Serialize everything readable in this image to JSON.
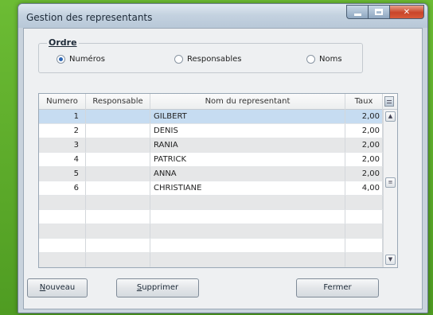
{
  "window": {
    "title": "Gestion des representants"
  },
  "ordre": {
    "label": "Ordre",
    "options": [
      {
        "label": "Numéros",
        "selected": true
      },
      {
        "label": "Responsables",
        "selected": false
      },
      {
        "label": "Noms",
        "selected": false
      }
    ]
  },
  "table": {
    "columns": [
      "Numero",
      "Responsable",
      "Nom du representant",
      "Taux"
    ],
    "rows": [
      {
        "numero": "1",
        "responsable": "",
        "nom": "GILBERT",
        "taux": "2,00"
      },
      {
        "numero": "2",
        "responsable": "",
        "nom": "DENIS",
        "taux": "2,00"
      },
      {
        "numero": "3",
        "responsable": "",
        "nom": "RANIA",
        "taux": "2,00"
      },
      {
        "numero": "4",
        "responsable": "",
        "nom": "PATRICK",
        "taux": "2,00"
      },
      {
        "numero": "5",
        "responsable": "",
        "nom": "ANNA",
        "taux": "2,00"
      },
      {
        "numero": "6",
        "responsable": "",
        "nom": "CHRISTIANE",
        "taux": "4,00"
      }
    ],
    "selected_row": 0
  },
  "buttons": {
    "nouveau_first": "N",
    "nouveau_rest": "ouveau",
    "supprimer_first": "S",
    "supprimer_rest": "upprimer",
    "fermer": "Fermer"
  }
}
